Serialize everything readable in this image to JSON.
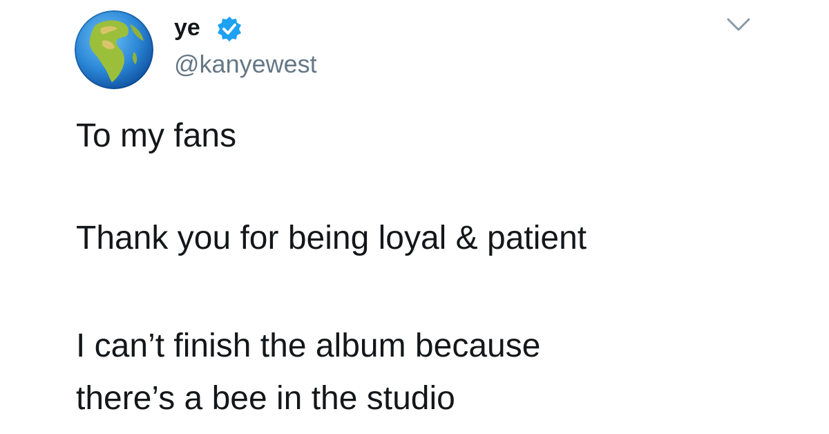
{
  "tweet": {
    "display_name": "ye",
    "handle": "@kanyewest",
    "verified": true,
    "avatar_icon": "earth-africa-globe-icon",
    "menu_icon": "chevron-down-icon",
    "lines": [
      "To my fans",
      "Thank you for being loyal & patient",
      "I can’t finish the album because",
      "there’s a bee in the studio"
    ]
  },
  "colors": {
    "text": "#14171a",
    "secondary_text": "#657786",
    "verified_badge": "#1da1f2",
    "background": "#ffffff"
  }
}
